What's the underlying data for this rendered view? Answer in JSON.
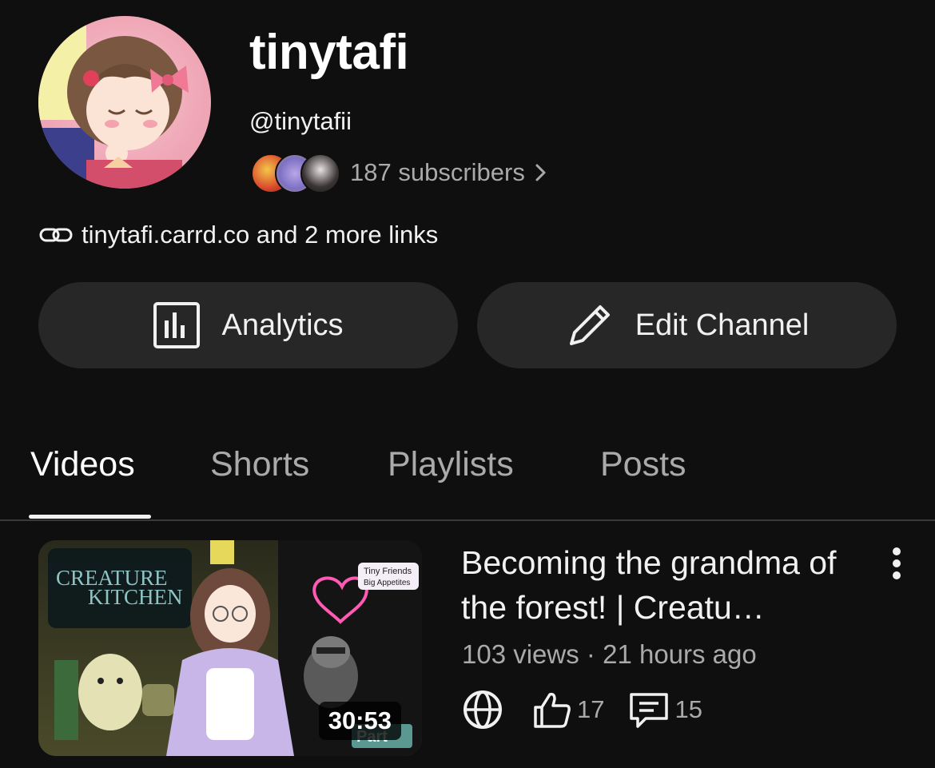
{
  "channel": {
    "name": "tinytafi",
    "handle": "@tinytafii",
    "subscribers": "187 subscribers",
    "links": "tinytafi.carrd.co and 2 more links"
  },
  "actions": {
    "analytics_label": "Analytics",
    "edit_label": "Edit Channel"
  },
  "tabs": [
    {
      "label": "Videos",
      "active": true
    },
    {
      "label": "Shorts",
      "active": false
    },
    {
      "label": "Playlists",
      "active": false
    },
    {
      "label": "Posts",
      "active": false
    }
  ],
  "videos": [
    {
      "title": "Becoming the grandma of the forest! | Creatu…",
      "duration": "30:53",
      "views": "103 views",
      "age": "21 hours ago",
      "likes": "17",
      "comments": "15",
      "thumbnail_text": {
        "logo_line1": "CREATURE",
        "logo_line2": "KITCHEN",
        "tag_line1": "Tiny Friends",
        "tag_line2": "Big Appetites",
        "part": "Part"
      }
    }
  ],
  "colors": {
    "background": "#0f0f0f",
    "button_bg": "#272727",
    "secondary_text": "#aaaaaa"
  }
}
